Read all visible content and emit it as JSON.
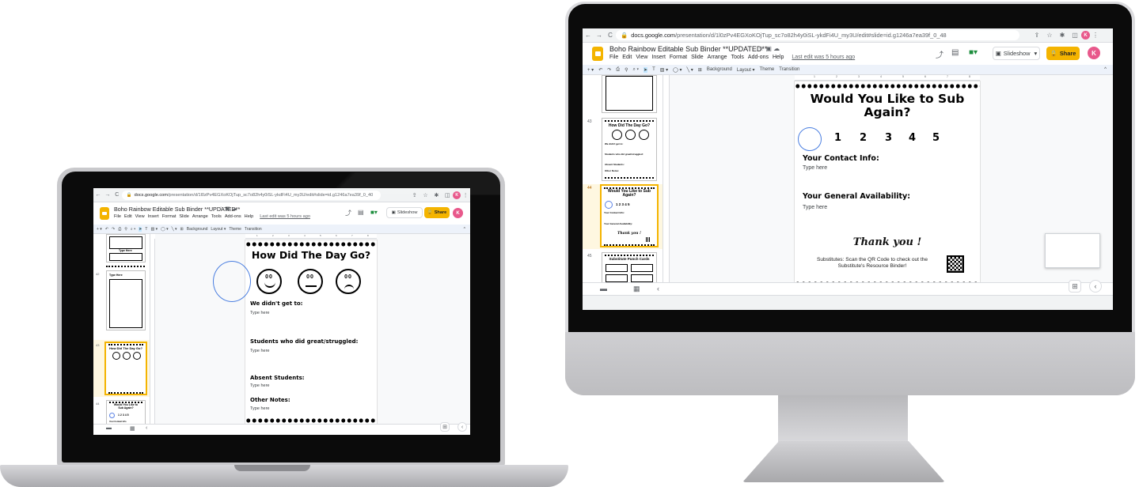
{
  "browser": {
    "back": "←",
    "forward": "→",
    "reload": "C",
    "url_host": "docs.google.com",
    "url_path_laptop": "/presentation/d/1l0zPv4EGXoKOjTup_sc7o82h4y0iSL-ykdFi4U_my3U/edit#slide=id.g1246a7ea39f_0_40",
    "url_path_imac": "/presentation/d/1l0zPv4EGXoKOjTup_sc7o82h4y0iSL-ykdFi4U_my3U/edit#slide=id.g1246a7ea39f_0_48",
    "profile_initial": "K"
  },
  "doc": {
    "title": "Boho Rainbow Editable Sub Binder **UPDATED**",
    "menus": [
      "File",
      "Edit",
      "View",
      "Insert",
      "Format",
      "Slide",
      "Arrange",
      "Tools",
      "Add-ons",
      "Help"
    ],
    "last_edit": "Last edit was 5 hours ago",
    "slideshow_label": "Slideshow",
    "share_label": "Share",
    "profile_initial": "K"
  },
  "toolbar": {
    "background": "Background",
    "layout": "Layout ▾",
    "theme": "Theme",
    "transition": "Transition"
  },
  "ruler": [
    "1",
    "2",
    "3",
    "4",
    "5",
    "6",
    "7",
    "8"
  ],
  "laptop_filmstrip": {
    "slide_41_label": "Type Here",
    "num_42": "42",
    "slide_42_label": "Type Here",
    "num_43": "43",
    "num_44": "44",
    "slide_43_title": "How Did The Day Go?",
    "slide_44_title": "Would You Like to Sub Again?",
    "slide_44_numbers": "1 2 3 4 5",
    "slide_44_contact": "Your Contact Info"
  },
  "laptop_slide": {
    "title": "How Did The Day Go?",
    "face_eyes": "00",
    "sections": [
      {
        "heading": "We didn't get to:",
        "body": "Type here"
      },
      {
        "heading": "Students who did great/struggled:",
        "body": "Type here"
      },
      {
        "heading": "Absent Students:",
        "body": "Type here"
      },
      {
        "heading": "Other Notes:",
        "body": "Type here"
      }
    ]
  },
  "imac_filmstrip": {
    "num_43": "43",
    "num_44": "44",
    "num_45": "45",
    "slide_43_title": "How Did The Day Go?",
    "slide_43_line1": "We didn't get to:",
    "slide_43_line2": "Students who did great/struggled:",
    "slide_43_line3": "Absent Students:",
    "slide_43_line4": "Other Notes:",
    "slide_44_title": "Would You Like to Sub Again?",
    "slide_44_numbers": "1 2 3 4 5",
    "slide_44_contact": "Your Contact Info:",
    "slide_44_avail": "Your General Availability:",
    "slide_44_thank": "Thank you !",
    "slide_45_title": "Substitute Punch Cards"
  },
  "imac_slide": {
    "title": "Would You Like to Sub Again?",
    "ratings": [
      "1",
      "2",
      "3",
      "4",
      "5"
    ],
    "contact_heading": "Your Contact Info:",
    "contact_body": "Type here",
    "availability_heading": "Your General Availability:",
    "availability_body": "Type here",
    "thank_you": "Thank you !",
    "footer_text": "Substitutes: Scan the QR Code to check out the Substitute's Resource Binder!"
  },
  "colors": {
    "slides_yellow": "#f4b400",
    "selection_blue": "#4a7ee0",
    "profile_pink": "#e8588b"
  }
}
